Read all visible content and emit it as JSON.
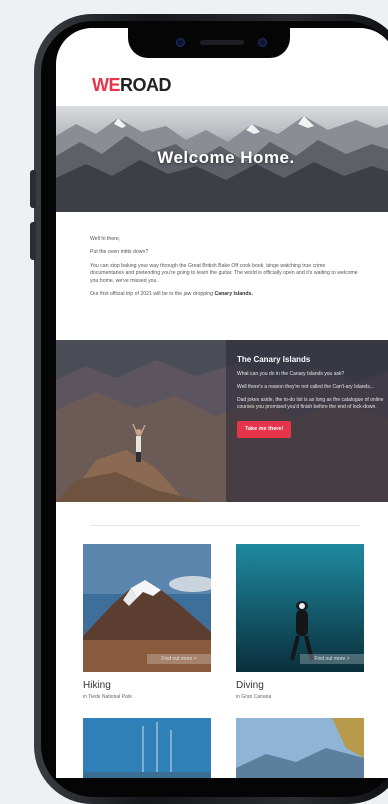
{
  "brand": {
    "logo_we": "WE",
    "logo_road": "ROAD"
  },
  "hero": {
    "title": "Welcome Home."
  },
  "intro": {
    "greeting": "Well hi there,",
    "line2": "Put the oven mitts down?",
    "line3": "You can stop baking your way through the Great British Bake Off cook book, binge watching true crime documentaries and pretending you're going to learn the guitar. The world is officially open and it's waiting to welcome you home, we've missed you.",
    "line4_prefix": "Our first official trip of 2021 will be to the jaw dropping",
    "line4_bold": "Canary Islands."
  },
  "canary": {
    "title": "The Canary Islands",
    "p1": "What can you do in the Canary Islands you ask?",
    "p2": "Well there's a reason they're not called the Can't-ary Islands...",
    "p3": "Dad jokes aside, the to-do list is as long as the catalogue of online courses you promised you'd finish before the end of lock-down.",
    "cta": "Take me there!"
  },
  "cards": [
    {
      "title": "Hiking",
      "sub": "in Tiede National Park",
      "ribbon": "Find out more >"
    },
    {
      "title": "Diving",
      "sub": "in Gran Canaria",
      "ribbon": "Find out more >"
    }
  ],
  "colors": {
    "accent": "#e8344a",
    "dark": "#222222"
  }
}
